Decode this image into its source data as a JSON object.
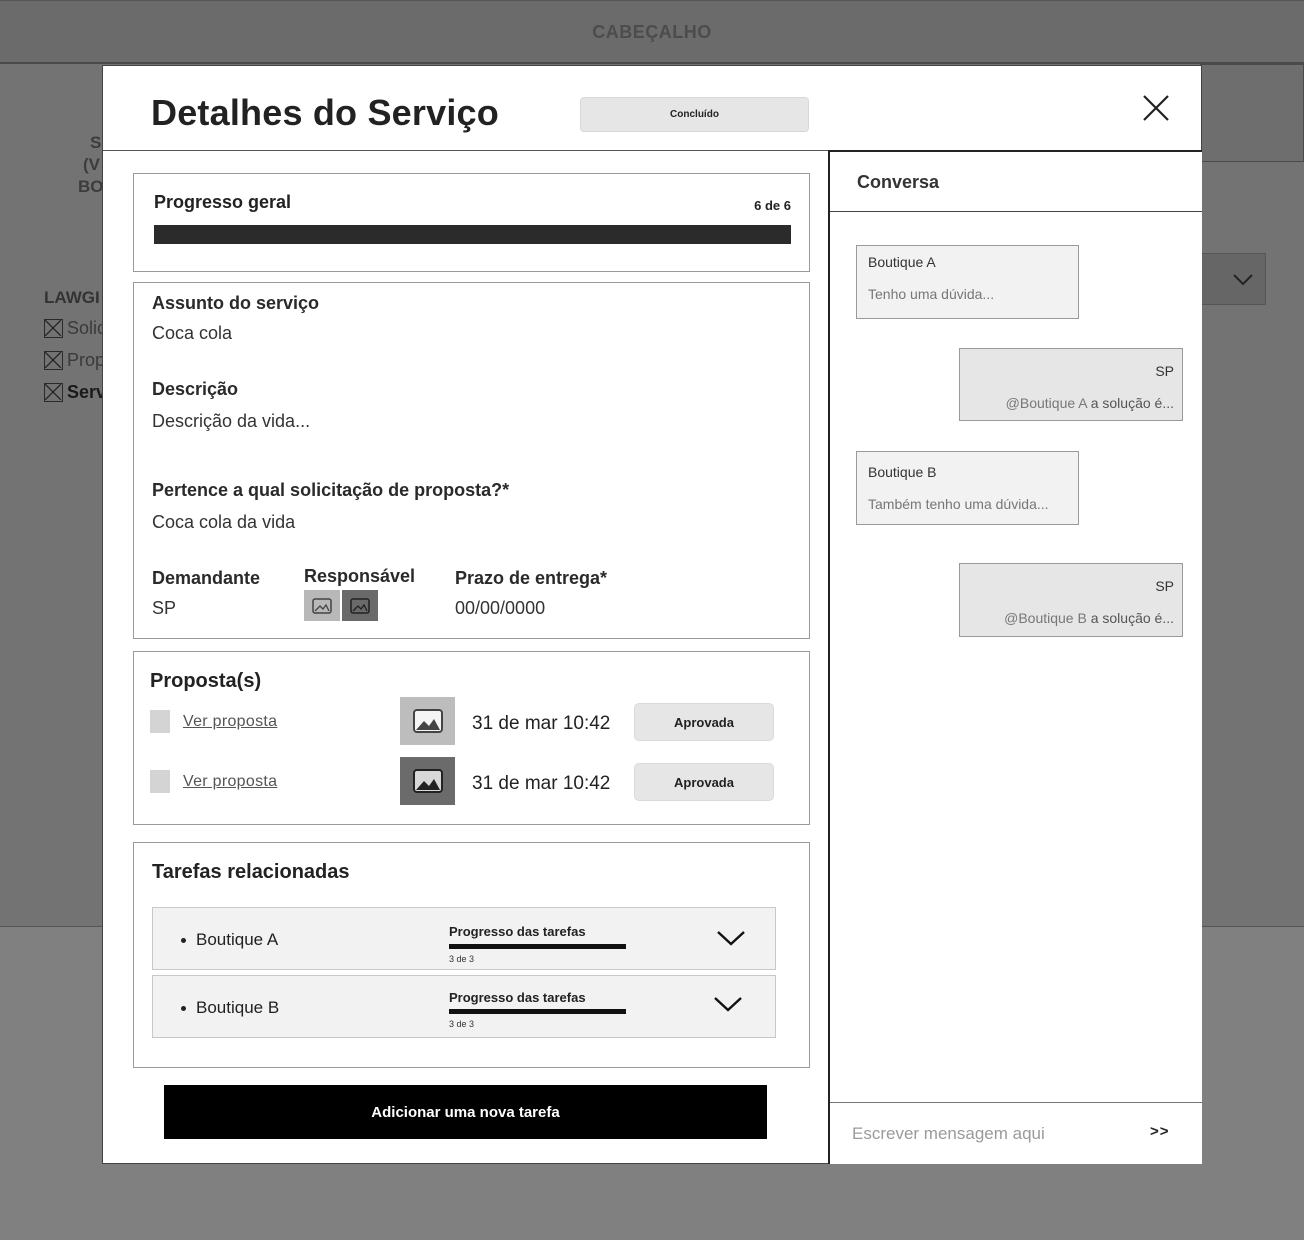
{
  "background": {
    "header_title": "CABEÇALHO",
    "frag_s": "S",
    "frag_v": "(V",
    "frag_bo": "BO",
    "sidebar_heading": "LAWGI",
    "sidebar_items": [
      {
        "label": "Solic"
      },
      {
        "label": "Prop"
      },
      {
        "label": "Serv"
      }
    ]
  },
  "modal": {
    "title": "Detalhes do Serviço",
    "status": "Concluído",
    "progress": {
      "label": "Progresso geral",
      "count": "6 de 6",
      "fraction": 1.0
    },
    "details": {
      "subject_label": "Assunto do serviço",
      "subject_value": "Coca cola",
      "description_label": "Descrição",
      "description_value": "Descrição da vida...",
      "proposal_request_label": "Pertence a qual solicitação de proposta?*",
      "proposal_request_value": "Coca cola da vida",
      "requester_label": "Demandante",
      "requester_value": "SP",
      "responsible_label": "Responsável",
      "deadline_label": "Prazo de entrega*",
      "deadline_value": "00/00/0000"
    },
    "proposals": {
      "title": "Proposta(s)",
      "items": [
        {
          "link": "Ver proposta",
          "date": "31 de mar 10:42",
          "status": "Aprovada"
        },
        {
          "link": "Ver proposta",
          "date": "31 de mar 10:42",
          "status": "Aprovada"
        }
      ]
    },
    "tasks": {
      "title": "Tarefas relacionadas",
      "items": [
        {
          "name": "Boutique A",
          "progress_label": "Progresso das tarefas",
          "count": "3 de 3",
          "fraction": 1.0
        },
        {
          "name": "Boutique B",
          "progress_label": "Progresso das tarefas",
          "count": "3 de 3",
          "fraction": 1.0
        }
      ]
    },
    "add_task_button": "Adicionar uma nova tarefa"
  },
  "chat": {
    "title": "Conversa",
    "messages": [
      {
        "author": "Boutique A",
        "text": "Tenho uma dúvida..."
      },
      {
        "author": "SP",
        "mention": "@Boutique A",
        "text": " a solução é..."
      },
      {
        "author": "Boutique B",
        "text": "Também tenho uma dúvida..."
      },
      {
        "author": "SP",
        "mention": "@Boutique B",
        "text": " a solução é..."
      }
    ],
    "input_placeholder": "Escrever mensagem aqui",
    "send_label": ">>"
  }
}
